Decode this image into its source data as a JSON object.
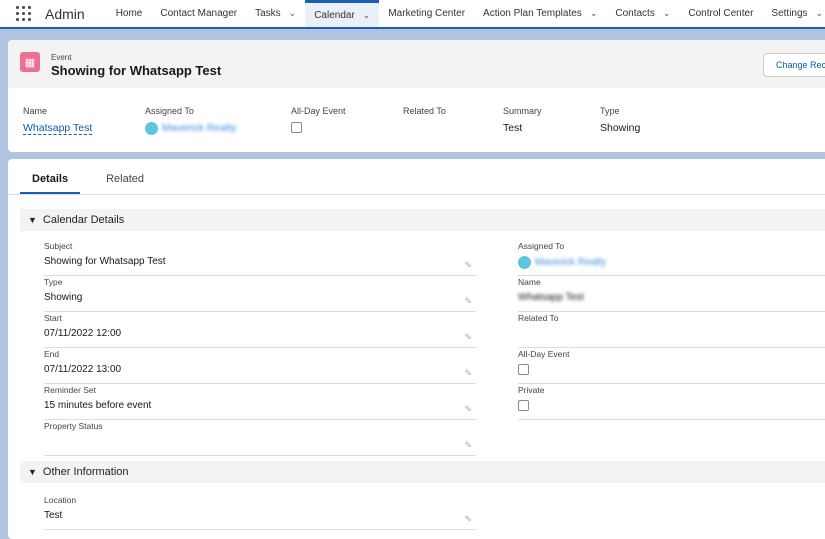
{
  "nav": {
    "app": "Admin",
    "items": [
      {
        "label": "Home",
        "chev": false
      },
      {
        "label": "Contact Manager",
        "chev": false
      },
      {
        "label": "Tasks",
        "chev": true
      },
      {
        "label": "Calendar",
        "chev": true,
        "active": true
      },
      {
        "label": "Marketing Center",
        "chev": false
      },
      {
        "label": "Action Plan Templates",
        "chev": true
      },
      {
        "label": "Contacts",
        "chev": true
      },
      {
        "label": "Control Center",
        "chev": false
      },
      {
        "label": "Settings",
        "chev": true
      }
    ]
  },
  "header": {
    "object": "Event",
    "title": "Showing for Whatsapp Test",
    "change_button": "Change Record Type"
  },
  "highlights": {
    "name_label": "Name",
    "name": "Whatsapp Test",
    "assigned_label": "Assigned To",
    "assigned": "Maverick Realty",
    "allday_label": "All-Day Event",
    "related_label": "Related To",
    "summary_label": "Summary",
    "summary": "Test",
    "type_label": "Type",
    "type": "Showing"
  },
  "tabs": {
    "details": "Details",
    "related": "Related"
  },
  "calendar_section": {
    "title": "Calendar Details",
    "left": [
      {
        "label": "Subject",
        "value": "Showing for Whatsapp Test"
      },
      {
        "label": "Type",
        "value": "Showing"
      },
      {
        "label": "Start",
        "value": "07/11/2022 12:00"
      },
      {
        "label": "End",
        "value": "07/11/2022 13:00"
      },
      {
        "label": "Reminder Set",
        "value": "15 minutes before event"
      },
      {
        "label": "Property Status",
        "value": ""
      }
    ],
    "right": {
      "assigned_label": "Assigned To",
      "assigned": "Maverick Realty",
      "name_label": "Name",
      "name": "Whatsapp Test",
      "related_label": "Related To",
      "allday_label": "All-Day Event",
      "private_label": "Private"
    }
  },
  "other_section": {
    "title": "Other Information",
    "location_label": "Location",
    "location": "Test"
  }
}
